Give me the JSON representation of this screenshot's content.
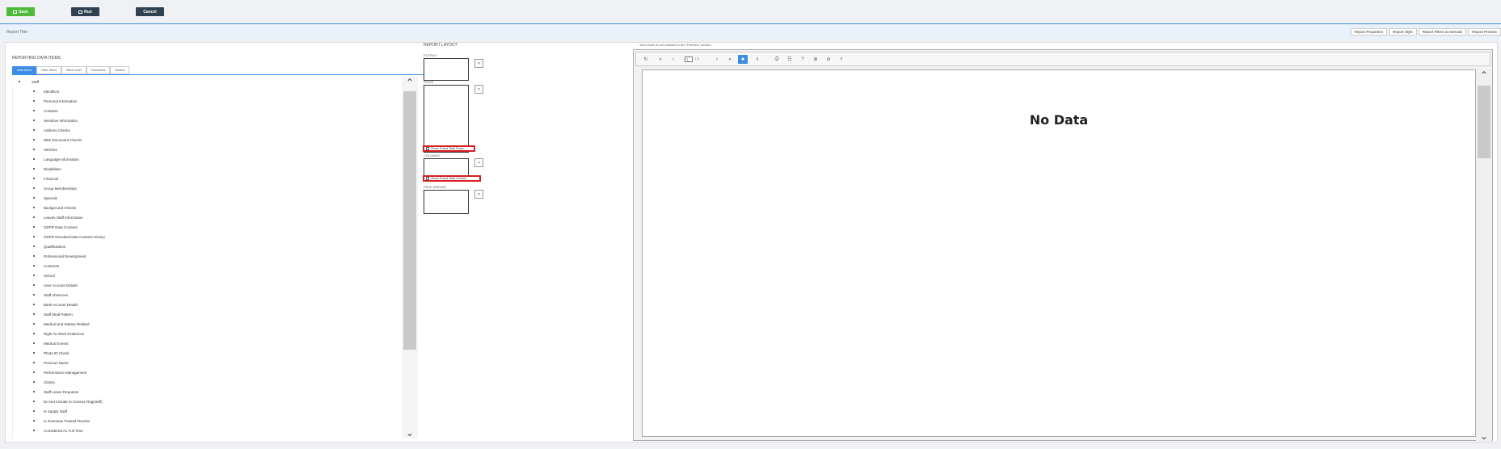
{
  "toolbar": {
    "save_label": "Save",
    "run_label": "Run",
    "cancel_label": "Cancel"
  },
  "titlebar": {
    "label": "Report Title:",
    "tabs": [
      "Report Properties",
      "Report Style",
      "Report Filters & Intervals",
      "Report Preview"
    ]
  },
  "left": {
    "title": "REPORTING DATA ITEMS",
    "tabs": [
      "Data Items",
      "Filter Items",
      "Merit Level",
      "Favourites",
      "Search"
    ],
    "root": "Staff",
    "items": [
      "Identifiers",
      "Personal Information",
      "Contacts",
      "Sensitive Information",
      "Address Checks",
      "DBS Document Checks",
      "Vehicles",
      "Language Information",
      "Disabilities",
      "Financial",
      "Group Memberships",
      "Specials",
      "Background Checks",
      "Leaves Staff Information",
      "GDPR Data Consent",
      "GDPR Revoked Data Consent History",
      "Qualifications",
      "Professional Development",
      "Contracts",
      "School",
      "User Account Details",
      "Staff Absences",
      "Bank Account Details",
      "Staff Meal Pattern",
      "Medical and Dietary Related",
      "Right To Work Evidences",
      "Medical Events",
      "Photo ID Check",
      "Previous Name",
      "Performance Management",
      "Claims",
      "Staff Leave Requests",
      "Do Not Include In Census Flag(staff)",
      "Is Supply Staff",
      "Is Overseas Trained Teacher",
      "Considered As Full Time"
    ]
  },
  "layout": {
    "title": "REPORT LAYOUT",
    "sections": {
      "extras": "EXTRAS",
      "rows": "ROWS",
      "columns": "COLUMNS",
      "page_breaks": "PAGE BREAKS"
    },
    "show_grand_total_rows": "Show Grand Total Rows",
    "show_grand_total_columns": "Show Grand Total Column",
    "remove_glyph": "×"
  },
  "preview": {
    "sort_note": "* Sort Order is not retained in the \"Preview\" section.",
    "page_current": "1",
    "page_total": "/ 1",
    "no_data": "No Data"
  }
}
